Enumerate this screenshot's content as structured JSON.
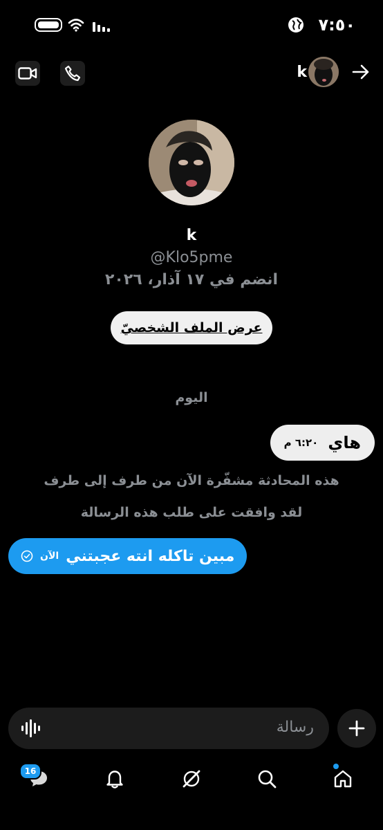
{
  "status_bar": {
    "time": "٧:٥٠"
  },
  "header": {
    "name": "k"
  },
  "profile": {
    "name": "k",
    "handle": "@Klo5pme",
    "joined": "انضم في ١٧ آذار، ٢٠٢٦",
    "view_profile_label": "عرض الملف الشخصيّ"
  },
  "chat": {
    "day_label": "اليوم",
    "incoming": {
      "text": "هاي",
      "time": "٦:٢٠ م"
    },
    "system_lines": [
      "هذه المحادثة مشفّرة الآن من طرف إلى طرف",
      "لقد وافقت على طلب هذه الرسالة"
    ],
    "outgoing": {
      "text": "مبين تاكله انته عجبتني",
      "time": "الآن"
    }
  },
  "composer": {
    "placeholder": "رسالة"
  },
  "nav": {
    "messages_badge": "16"
  },
  "colors": {
    "accent": "#1d9bf0",
    "background": "#000000"
  }
}
